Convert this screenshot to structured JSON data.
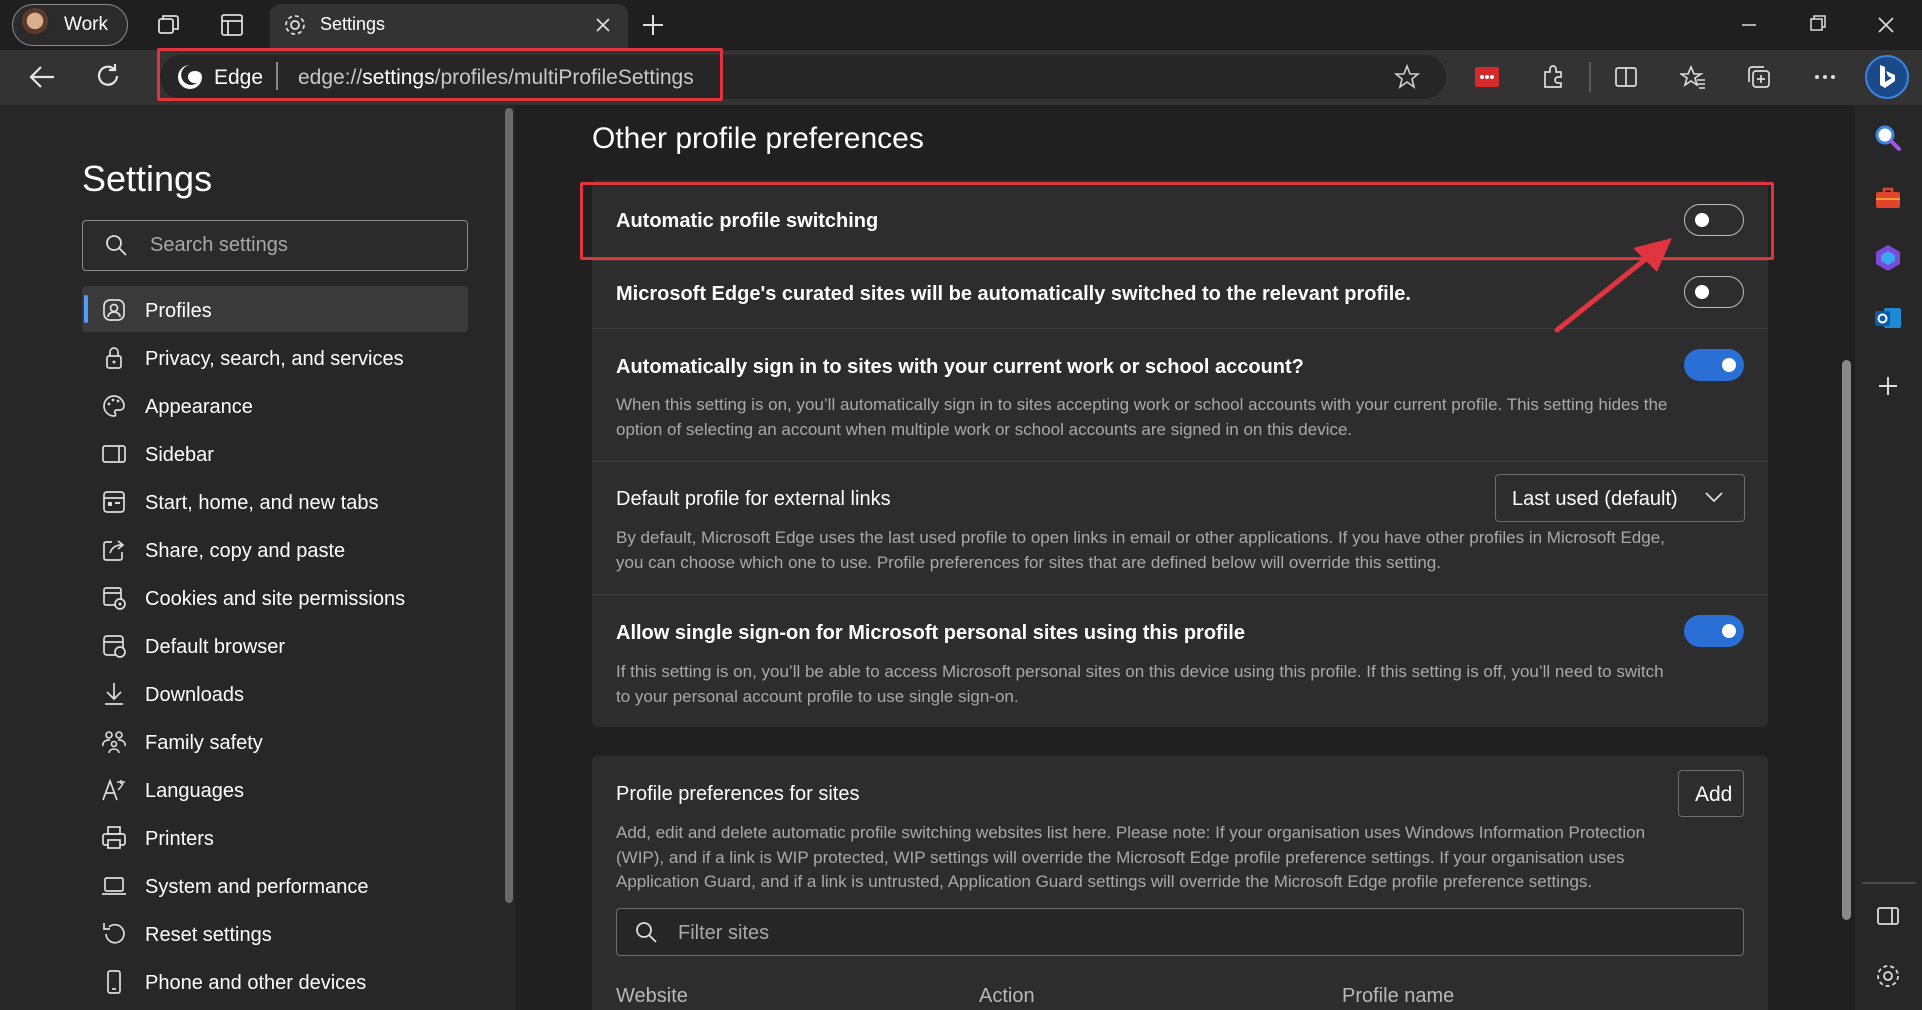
{
  "titlebar": {
    "profile_label": "Work",
    "tab_title": "Settings"
  },
  "address_bar": {
    "site_label": "Edge",
    "url_prefix": "edge://",
    "url_bold": "settings",
    "url_rest": "/profiles/multiProfileSettings"
  },
  "sidebar": {
    "title": "Settings",
    "search_placeholder": "Search settings",
    "items": [
      {
        "label": "Profiles",
        "icon": "profile-icon"
      },
      {
        "label": "Privacy, search, and services",
        "icon": "lock-icon"
      },
      {
        "label": "Appearance",
        "icon": "palette-icon"
      },
      {
        "label": "Sidebar",
        "icon": "sidebar-icon"
      },
      {
        "label": "Start, home, and new tabs",
        "icon": "home-tabs-icon"
      },
      {
        "label": "Share, copy and paste",
        "icon": "share-icon"
      },
      {
        "label": "Cookies and site permissions",
        "icon": "cookie-icon"
      },
      {
        "label": "Default browser",
        "icon": "browser-icon"
      },
      {
        "label": "Downloads",
        "icon": "download-icon"
      },
      {
        "label": "Family safety",
        "icon": "family-icon"
      },
      {
        "label": "Languages",
        "icon": "language-icon"
      },
      {
        "label": "Printers",
        "icon": "printer-icon"
      },
      {
        "label": "System and performance",
        "icon": "laptop-icon"
      },
      {
        "label": "Reset settings",
        "icon": "reset-icon"
      },
      {
        "label": "Phone and other devices",
        "icon": "phone-icon"
      }
    ]
  },
  "main": {
    "section_title": "Other profile preferences",
    "rows": [
      {
        "title": "Automatic profile switching",
        "toggle": "off"
      },
      {
        "title": "Microsoft Edge's curated sites will be automatically switched to the relevant profile.",
        "toggle": "off"
      },
      {
        "title": "Automatically sign in to sites with your current work or school account?",
        "toggle": "on",
        "desc1": "When this setting is on, you’ll automatically sign in to sites accepting work or school accounts with your current profile. This setting hides the",
        "desc2": "option of selecting an account when multiple work or school accounts are signed in on this device."
      },
      {
        "title": "Default profile for external links",
        "dropdown": "Last used (default)",
        "desc1": "By default, Microsoft Edge uses the last used profile to open links in email or other applications. If you have other profiles in Microsoft Edge,",
        "desc2": "you can choose which one to use. Profile preferences for sites that are defined below will override this setting."
      },
      {
        "title": "Allow single sign-on for Microsoft personal sites using this profile",
        "toggle": "on",
        "desc1": "If this setting is on, you’ll be able to access Microsoft personal sites on this device using this profile. If this setting is off, you’ll need to switch",
        "desc2": "to your personal account profile to use single sign-on."
      }
    ],
    "sites": {
      "title": "Profile preferences for sites",
      "add_label": "Add",
      "desc1": "Add, edit and delete automatic profile switching websites list here. Please note: If your organisation uses Windows Information Protection",
      "desc2": "(WIP), and if a link is WIP protected, WIP settings will override the Microsoft Edge profile preference settings. If your organisation uses",
      "desc3": "Application Guard, and if a link is untrusted, Application Guard settings will override the Microsoft Edge profile preference settings.",
      "filter_placeholder": "Filter sites",
      "columns": [
        "Website",
        "Action",
        "Profile name"
      ]
    }
  },
  "colors": {
    "accent": "#2a6fd6",
    "highlight": "#e0343f",
    "background": "#202020"
  }
}
